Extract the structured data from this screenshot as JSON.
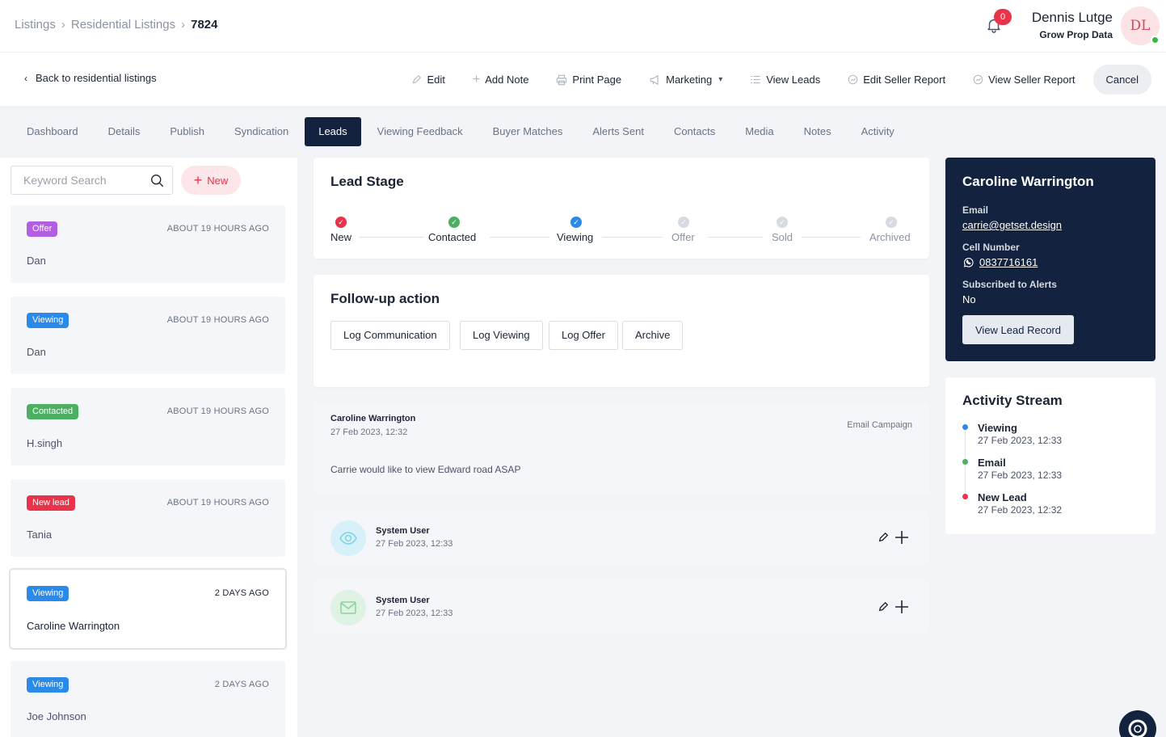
{
  "breadcrumb": {
    "items": [
      "Listings",
      "Residential Listings",
      "7824"
    ]
  },
  "notifications": {
    "count": "0"
  },
  "user": {
    "name": "Dennis Lutge",
    "org": "Grow Prop Data",
    "initials": "DL"
  },
  "actionbar": {
    "back_label": "Back to residential listings",
    "edit": "Edit",
    "add_note": "Add Note",
    "print_page": "Print Page",
    "marketing": "Marketing",
    "view_leads": "View Leads",
    "edit_seller_report": "Edit Seller Report",
    "view_seller_report": "View Seller Report",
    "cancel": "Cancel"
  },
  "tabs": [
    "Dashboard",
    "Details",
    "Publish",
    "Syndication",
    "Leads",
    "Viewing Feedback",
    "Buyer Matches",
    "Alerts Sent",
    "Contacts",
    "Media",
    "Notes",
    "Activity"
  ],
  "active_tab": "Leads",
  "search": {
    "placeholder": "Keyword Search"
  },
  "new_button": "New",
  "leads": [
    {
      "badge": "Offer",
      "badge_color": "#b15fe0",
      "ago": "ABOUT 19 HOURS AGO",
      "name": "Dan"
    },
    {
      "badge": "Viewing",
      "badge_color": "#2b8ae8",
      "ago": "ABOUT 19 HOURS AGO",
      "name": "Dan"
    },
    {
      "badge": "Contacted",
      "badge_color": "#4caf62",
      "ago": "ABOUT 19 HOURS AGO",
      "name": "H.singh"
    },
    {
      "badge": "New lead",
      "badge_color": "#e8334a",
      "ago": "ABOUT 19 HOURS AGO",
      "name": "Tania"
    },
    {
      "badge": "Viewing",
      "badge_color": "#2b8ae8",
      "ago": "2 DAYS AGO",
      "name": "Caroline Warrington"
    },
    {
      "badge": "Viewing",
      "badge_color": "#2b8ae8",
      "ago": "2 DAYS AGO",
      "name": "Joe Johnson"
    }
  ],
  "lead_stage": {
    "title": "Lead Stage",
    "stages": [
      {
        "label": "New",
        "state": "done",
        "color": "#e8334a"
      },
      {
        "label": "Contacted",
        "state": "done",
        "color": "#4caf62"
      },
      {
        "label": "Viewing",
        "state": "current",
        "color": "#2b8ae8"
      },
      {
        "label": "Offer",
        "state": "pending",
        "color": "#d6dae1"
      },
      {
        "label": "Sold",
        "state": "pending",
        "color": "#d6dae1"
      },
      {
        "label": "Archived",
        "state": "pending",
        "color": "#d6dae1"
      }
    ]
  },
  "follow_up": {
    "title": "Follow-up action",
    "buttons": [
      "Log Communication",
      "Log Viewing",
      "Log Offer",
      "Archive"
    ]
  },
  "message": {
    "author": "Caroline Warrington",
    "date": "27 Feb 2023, 12:32",
    "source": "Email Campaign",
    "body": "Carrie would like to view Edward road ASAP"
  },
  "activities": [
    {
      "user": "System User",
      "date": "27 Feb 2023, 12:33",
      "icon": "eye-icon"
    },
    {
      "user": "System User",
      "date": "27 Feb 2023, 12:33",
      "icon": "envelope-icon"
    }
  ],
  "contact": {
    "name": "Caroline Warrington",
    "email_label": "Email",
    "email": "carrie@getset.design",
    "cell_label": "Cell Number",
    "cell": "0837716161",
    "alerts_label": "Subscribed to Alerts",
    "alerts": "No",
    "view_button": "View Lead Record"
  },
  "stream": {
    "title": "Activity Stream",
    "items": [
      {
        "title": "Viewing",
        "date": "27 Feb 2023, 12:33",
        "color": "#2b8ae8"
      },
      {
        "title": "Email",
        "date": "27 Feb 2023, 12:33",
        "color": "#4caf62"
      },
      {
        "title": "New Lead",
        "date": "27 Feb 2023, 12:32",
        "color": "#e8334a"
      }
    ]
  }
}
